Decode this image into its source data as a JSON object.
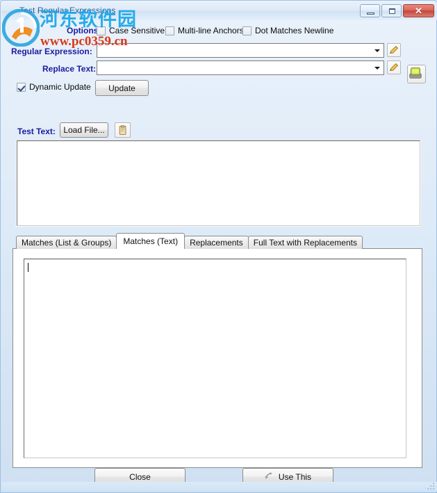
{
  "window": {
    "title": "Test Regular Expressions",
    "controls": {
      "minimize": "Minimize",
      "maximize": "Maximize",
      "close": "✕"
    }
  },
  "watermark": {
    "site_cn": "河东软件园",
    "site_url": "www.pc0359.cn"
  },
  "options": {
    "label": "Options:",
    "items": [
      {
        "label": "Case Sensitive",
        "checked": false
      },
      {
        "label": "Multi-line Anchors",
        "checked": false
      },
      {
        "label": "Dot Matches Newline",
        "checked": false
      }
    ]
  },
  "fields": {
    "regex": {
      "label": "Regular Expression:",
      "value": "",
      "placeholder": ""
    },
    "replace": {
      "label": "Replace Text:",
      "value": "",
      "placeholder": ""
    },
    "edit_regex_button": "edit-pencil-icon",
    "edit_replace_button": "edit-pencil-icon",
    "library_button": "regex-library-icon"
  },
  "update_row": {
    "dynamic_update_label": "Dynamic Update",
    "dynamic_update_checked": true,
    "update_button": "Update"
  },
  "test_text": {
    "label": "Test Text:",
    "load_file_button": "Load File...",
    "paste_button": "clipboard-paste-icon",
    "value": ""
  },
  "tabs": [
    {
      "label": "Matches (List & Groups)",
      "active": false
    },
    {
      "label": "Matches (Text)",
      "active": true
    },
    {
      "label": "Replacements",
      "active": false
    },
    {
      "label": "Full Text with Replacements",
      "active": false
    }
  ],
  "results": {
    "value": ""
  },
  "footer": {
    "close_button": "Close",
    "use_this_button": "Use This"
  },
  "colors": {
    "label_blue": "#1b1b9e",
    "title_blue": "#2b5f97",
    "watermark_cyan": "#1aa7e8",
    "watermark_red": "#d83a1b",
    "close_red": "#c4463c"
  }
}
